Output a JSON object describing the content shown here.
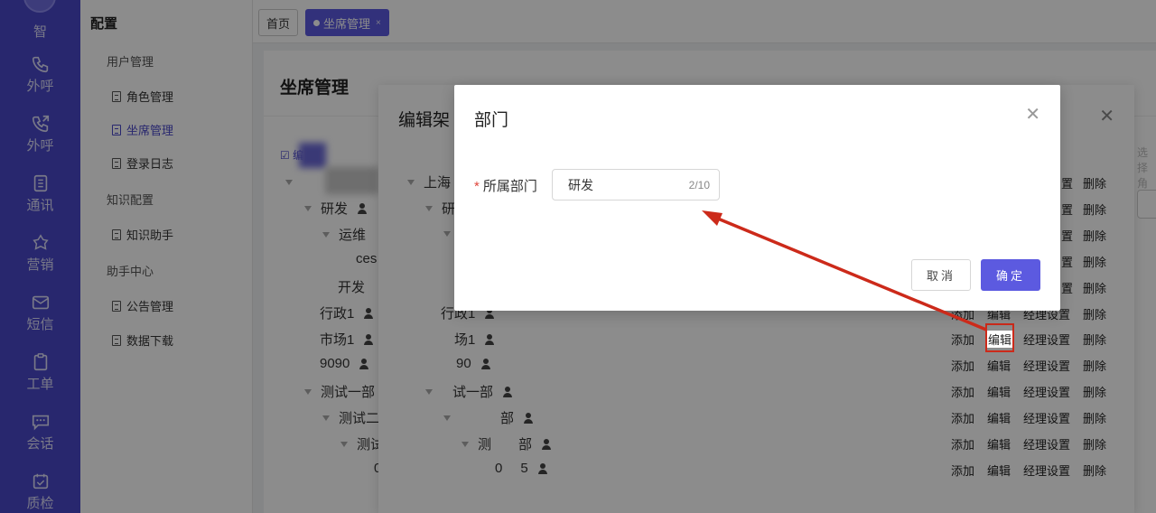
{
  "rail": {
    "items": [
      {
        "label": "智",
        "icon": "robot-icon"
      },
      {
        "label": "外呼",
        "icon": "phone-icon"
      },
      {
        "label": "外呼",
        "icon": "phone-outgoing-icon"
      },
      {
        "label": "通讯",
        "icon": "contacts-icon"
      },
      {
        "label": "营销",
        "icon": "marketing-icon"
      },
      {
        "label": "短信",
        "icon": "sms-icon"
      },
      {
        "label": "工单",
        "icon": "ticket-icon"
      },
      {
        "label": "会话",
        "icon": "chat-icon"
      },
      {
        "label": "质检",
        "icon": "quality-check-icon"
      }
    ]
  },
  "subnav": {
    "title": "配置",
    "groups": [
      {
        "label": "用户管理",
        "items": [
          "角色管理",
          "坐席管理",
          "登录日志"
        ]
      },
      {
        "label": "知识配置",
        "items": [
          "知识助手"
        ]
      },
      {
        "label": "助手中心",
        "items": [
          "公告管理",
          "数据下载"
        ]
      }
    ]
  },
  "tabs": [
    {
      "label": "首页"
    },
    {
      "label": "坐席管理",
      "close": "×"
    }
  ],
  "main": {
    "title": "坐席管理",
    "edit_label": "编",
    "tree": [
      "研发",
      "运维",
      "ces",
      "开发",
      "行政1",
      "市场1",
      "9090",
      "测试一部",
      "测试二",
      "测试",
      "0"
    ]
  },
  "dialog2": {
    "title": "编辑架",
    "right_placeholder": "选择角",
    "tree": [
      "上海",
      "研",
      "行政1",
      "场1",
      "90",
      "试一部",
      "部",
      "测",
      "部",
      "0",
      "5"
    ],
    "actions": {
      "add": "添加",
      "edit": "编辑",
      "manager": "经理设置",
      "delete": "删除",
      "partial_manager": "置"
    }
  },
  "dialog": {
    "title": "部门",
    "close": "×",
    "field_label": "所属部门",
    "required_mark": "*",
    "field_value": "研发",
    "field_count": "2/10",
    "cancel": "取消",
    "ok": "确定"
  },
  "colors": {
    "primary": "#5c5ae0",
    "rail": "#4a47c9",
    "annotation": "#cc2a1a"
  }
}
